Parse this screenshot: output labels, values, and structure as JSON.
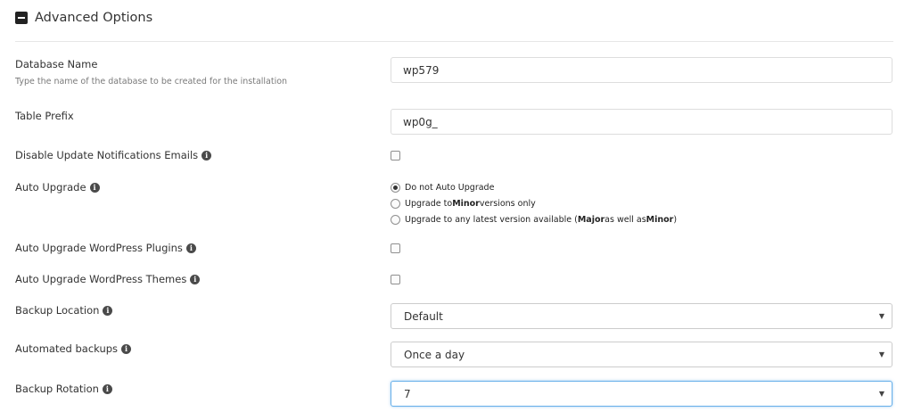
{
  "header": {
    "title": "Advanced Options",
    "icon": "minus-square-icon"
  },
  "fields": {
    "database_name": {
      "label": "Database Name",
      "help": "Type the name of the database to be created for the installation",
      "value": "wp579"
    },
    "table_prefix": {
      "label": "Table Prefix",
      "value": "wp0g_"
    },
    "disable_update_notifications": {
      "label": "Disable Update Notifications Emails",
      "checked": false
    },
    "auto_upgrade": {
      "label": "Auto Upgrade",
      "options": [
        {
          "parts": [
            "Do not Auto Upgrade"
          ],
          "selected": true
        },
        {
          "parts": [
            "Upgrade to ",
            "Minor",
            " versions only"
          ],
          "selected": false
        },
        {
          "parts": [
            "Upgrade to any latest version available (",
            "Major",
            " as well as ",
            "Minor",
            ")"
          ],
          "selected": false
        }
      ]
    },
    "auto_upgrade_plugins": {
      "label": "Auto Upgrade WordPress Plugins",
      "checked": false
    },
    "auto_upgrade_themes": {
      "label": "Auto Upgrade WordPress Themes",
      "checked": false
    },
    "backup_location": {
      "label": "Backup Location",
      "value": "Default"
    },
    "automated_backups": {
      "label": "Automated backups",
      "value": "Once a day"
    },
    "backup_rotation": {
      "label": "Backup Rotation",
      "value": "7"
    }
  },
  "colors": {
    "focus_border": "#66afe9",
    "input_border": "#dddddd",
    "text": "#333333"
  }
}
